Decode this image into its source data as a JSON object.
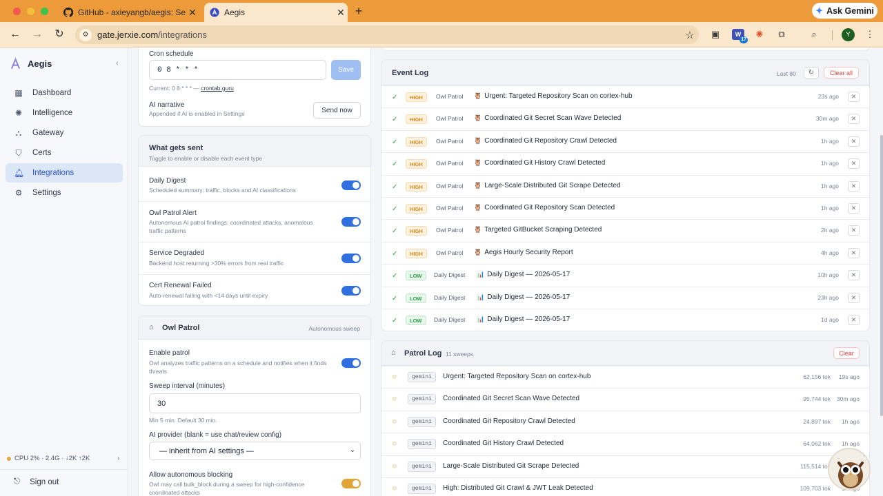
{
  "browser": {
    "tabs": [
      {
        "title": "GitHub - axieyangb/aegis: Se"
      },
      {
        "title": "Aegis"
      }
    ],
    "url_host": "gate.jerxie.com",
    "url_path": "/integrations",
    "ask_gemini": "Ask Gemini",
    "extension_badge_count": "17",
    "profile_initial": "Y"
  },
  "sidebar": {
    "brand": "Aegis",
    "items": [
      {
        "label": "Dashboard",
        "icon": "grid-icon"
      },
      {
        "label": "Intelligence",
        "icon": "brain-icon"
      },
      {
        "label": "Gateway",
        "icon": "network-icon"
      },
      {
        "label": "Certs",
        "icon": "shield-icon"
      },
      {
        "label": "Integrations",
        "icon": "bell-icon",
        "active": true
      },
      {
        "label": "Settings",
        "icon": "gear-icon"
      }
    ],
    "cpu_status": "CPU 2% · 2.4G · ↓2K ↑2K",
    "sign_out": "Sign out"
  },
  "schedule": {
    "cron_label": "Cron schedule",
    "cron_value": "0 8 * * *",
    "save": "Save",
    "current_prefix": "Current: 0 8 * * * —",
    "current_link": "crontab.guru",
    "ai_narrative_label": "AI narrative",
    "ai_narrative_sub": "Appended if AI is enabled in Settings",
    "send_now": "Send now"
  },
  "what_gets_sent": {
    "title": "What gets sent",
    "subtitle": "Toggle to enable or disable each event type",
    "items": [
      {
        "label": "Daily Digest",
        "desc": "Scheduled summary: traffic, blocks and AI classifications",
        "enabled": true
      },
      {
        "label": "Owl Patrol Alert",
        "desc": "Autonomous AI patrol findings: coordinated attacks, anomalous traffic patterns",
        "enabled": true
      },
      {
        "label": "Service Degraded",
        "desc": "Backend host returning >30% errors from real traffic",
        "enabled": true
      },
      {
        "label": "Cert Renewal Failed",
        "desc": "Auto-renewal failing with <14 days until expiry",
        "enabled": true
      }
    ]
  },
  "owl_patrol": {
    "title": "Owl Patrol",
    "tag": "Autonomous sweep",
    "enable_label": "Enable patrol",
    "enable_desc": "Owl analyzes traffic patterns on a schedule and notifies when it finds threats",
    "enabled": true,
    "interval_label": "Sweep interval (minutes)",
    "interval_value": "30",
    "interval_hint": "Min 5 min. Default 30 min.",
    "provider_label": "AI provider (blank = use chat/review config)",
    "provider_value": "— inherit from AI settings —",
    "blocking_label": "Allow autonomous blocking",
    "blocking_desc": "Owl may call bulk_block during a sweep for high-confidence coordinated attacks",
    "blocking_enabled": true
  },
  "event_log": {
    "title": "Event Log",
    "count": "Last 80",
    "clear_all": "Clear all",
    "rows": [
      {
        "level": "HIGH",
        "source": "Owl Patrol",
        "emoji": "🦉",
        "title": "Urgent: Targeted Repository Scan on cortex-hub",
        "ago": "23s ago"
      },
      {
        "level": "HIGH",
        "source": "Owl Patrol",
        "emoji": "🦉",
        "title": "Coordinated Git Secret Scan Wave Detected",
        "ago": "30m ago"
      },
      {
        "level": "HIGH",
        "source": "Owl Patrol",
        "emoji": "🦉",
        "title": "Coordinated Git Repository Crawl Detected",
        "ago": "1h ago"
      },
      {
        "level": "HIGH",
        "source": "Owl Patrol",
        "emoji": "🦉",
        "title": "Coordinated Git History Crawl Detected",
        "ago": "1h ago"
      },
      {
        "level": "HIGH",
        "source": "Owl Patrol",
        "emoji": "🦉",
        "title": "Large-Scale Distributed Git Scrape Detected",
        "ago": "1h ago"
      },
      {
        "level": "HIGH",
        "source": "Owl Patrol",
        "emoji": "🦉",
        "title": "Coordinated Git Repository Scan Detected",
        "ago": "1h ago"
      },
      {
        "level": "HIGH",
        "source": "Owl Patrol",
        "emoji": "🦉",
        "title": "Targeted GitBucket Scraping Detected",
        "ago": "2h ago"
      },
      {
        "level": "HIGH",
        "source": "Owl Patrol",
        "emoji": "🦉",
        "title": "Aegis Hourly Security Report",
        "ago": "4h ago"
      },
      {
        "level": "LOW",
        "source": "Daily Digest",
        "emoji": "📊",
        "title": "Daily Digest — 2026-05-17",
        "ago": "10h ago"
      },
      {
        "level": "LOW",
        "source": "Daily Digest",
        "emoji": "📊",
        "title": "Daily Digest — 2026-05-17",
        "ago": "23h ago"
      },
      {
        "level": "LOW",
        "source": "Daily Digest",
        "emoji": "📊",
        "title": "Daily Digest — 2026-05-17",
        "ago": "1d ago"
      }
    ]
  },
  "patrol_log": {
    "title": "Patrol Log",
    "count": "11 sweeps",
    "clear": "Clear",
    "rows": [
      {
        "provider": "gemini",
        "title": "Urgent: Targeted Repository Scan on cortex-hub",
        "tokens": "62,156 tok",
        "ago": "19s ago"
      },
      {
        "provider": "gemini",
        "title": "Coordinated Git Secret Scan Wave Detected",
        "tokens": "95,744 tok",
        "ago": "30m ago"
      },
      {
        "provider": "gemini",
        "title": "Coordinated Git Repository Crawl Detected",
        "tokens": "24,897 tok",
        "ago": "1h ago"
      },
      {
        "provider": "gemini",
        "title": "Coordinated Git History Crawl Detected",
        "tokens": "64,062 tok",
        "ago": "1h ago"
      },
      {
        "provider": "gemini",
        "title": "Large-Scale Distributed Git Scrape Detected",
        "tokens": "115,514 tok",
        "ago": "1h ago"
      },
      {
        "provider": "gemini",
        "title": "High: Distributed Git Crawl & JWT Leak Detected",
        "tokens": "109,703 tok",
        "ago": "1h ago"
      }
    ]
  }
}
